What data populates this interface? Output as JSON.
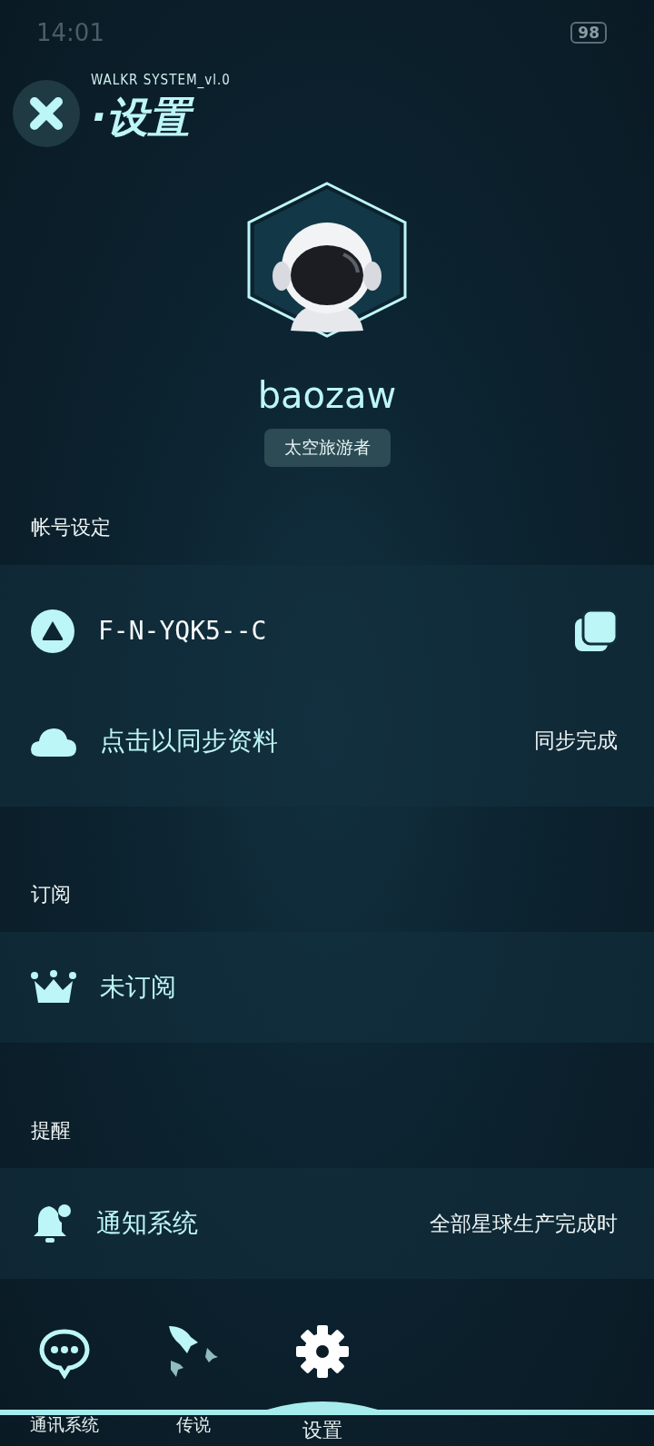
{
  "status_bar": {
    "time": "14:01",
    "battery": "98"
  },
  "header": {
    "subtitle": "WALKR SYSTEM_vl.0",
    "title": "·设置"
  },
  "profile": {
    "username": "baozaw",
    "badge": "太空旅游者"
  },
  "sections": [
    {
      "title": "帐号设定",
      "rows": [
        {
          "kind": "code",
          "label": "F-N-YQK5--C"
        },
        {
          "kind": "value",
          "label": "点击以同步资料",
          "value": "同步完成"
        }
      ]
    },
    {
      "title": "订阅",
      "rows": [
        {
          "kind": "plain",
          "label": "未订阅"
        }
      ]
    },
    {
      "title": "提醒",
      "rows": [
        {
          "kind": "value",
          "label": "通知系统",
          "value": "全部星球生产完成时"
        }
      ]
    }
  ],
  "tabs": [
    {
      "label": "通讯系统",
      "selected": false
    },
    {
      "label": "传说",
      "selected": false
    },
    {
      "label": "设置",
      "selected": true
    }
  ]
}
